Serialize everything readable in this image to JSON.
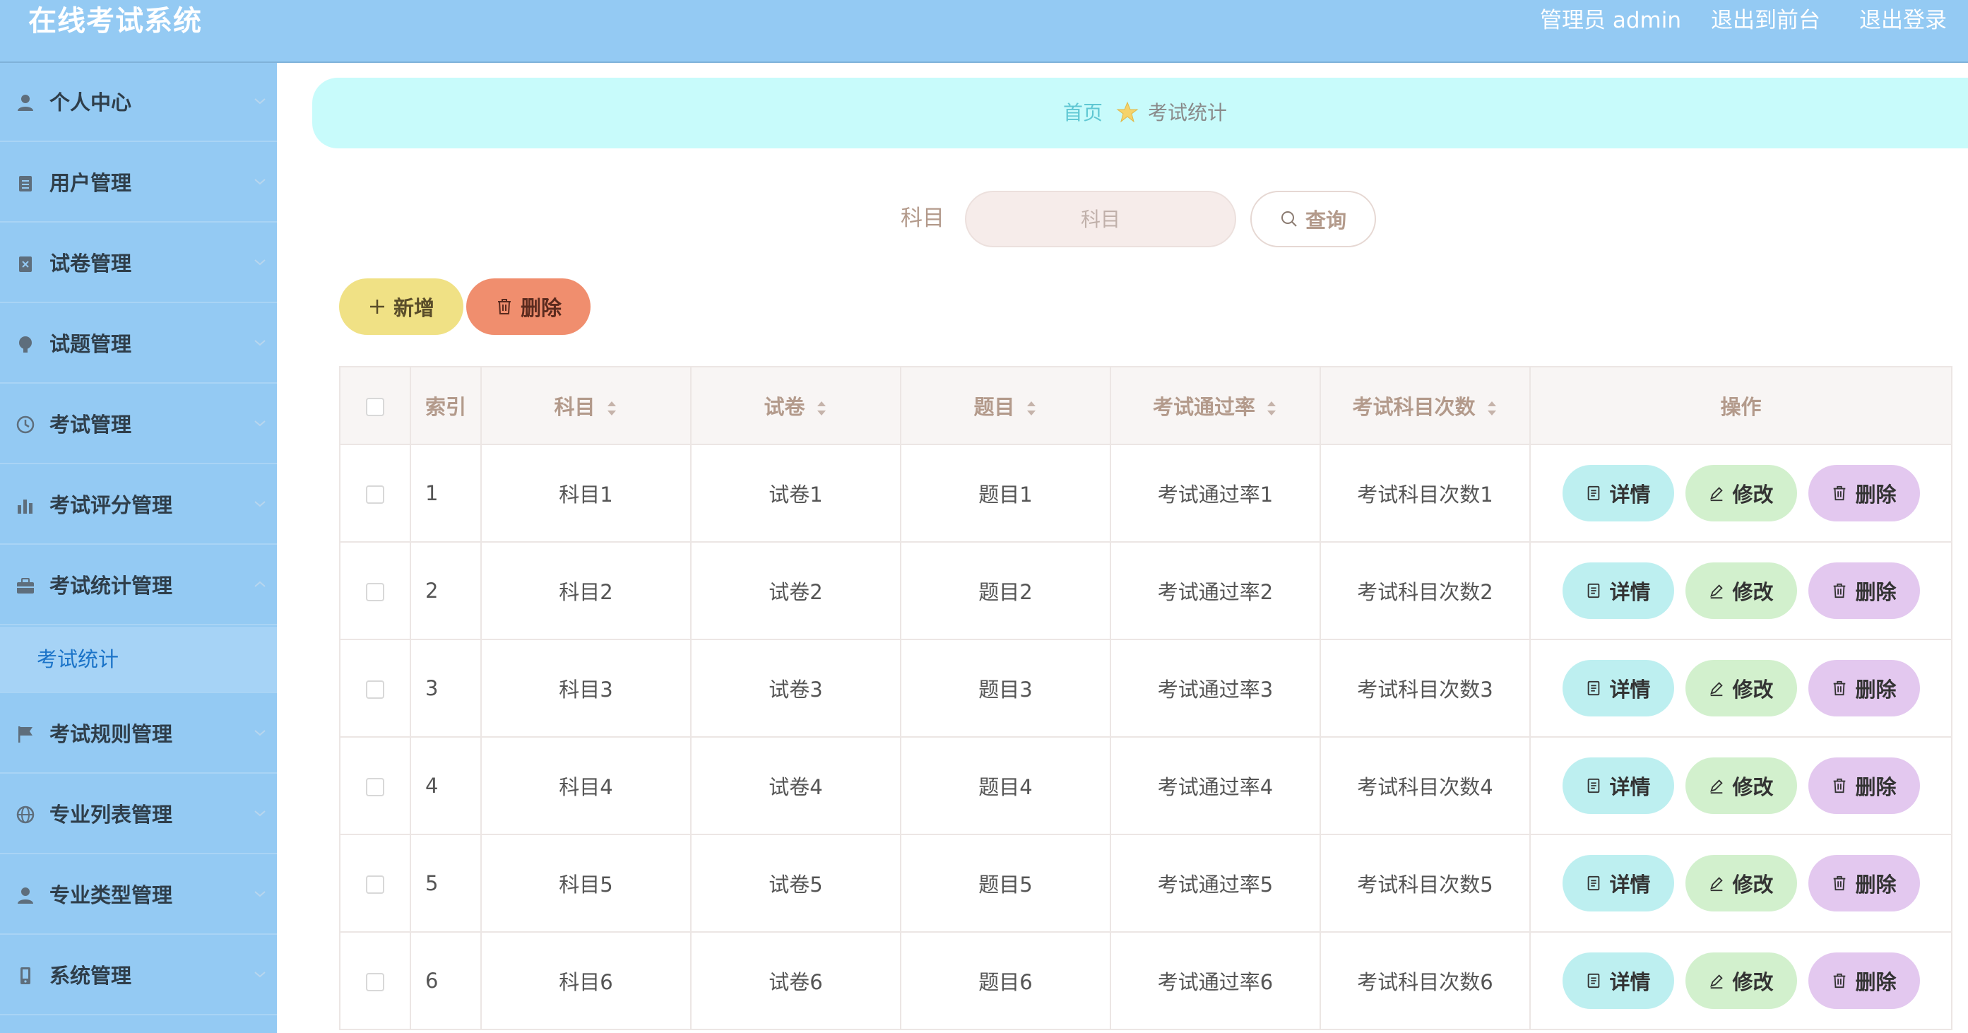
{
  "header": {
    "title": "在线考试系统",
    "user_label": "管理员 admin",
    "front_link": "退出到前台",
    "logout_link": "退出登录"
  },
  "sidebar": {
    "items": [
      {
        "label": "个人中心",
        "icon": "user-icon"
      },
      {
        "label": "用户管理",
        "icon": "clipboard-icon"
      },
      {
        "label": "试卷管理",
        "icon": "document-icon"
      },
      {
        "label": "试题管理",
        "icon": "lightbulb-icon"
      },
      {
        "label": "考试管理",
        "icon": "clock-icon"
      },
      {
        "label": "考试评分管理",
        "icon": "bar-chart-icon"
      },
      {
        "label": "考试统计管理",
        "icon": "briefcase-icon",
        "expanded": true
      },
      {
        "label": "考试规则管理",
        "icon": "flag-icon"
      },
      {
        "label": "专业列表管理",
        "icon": "globe-icon"
      },
      {
        "label": "专业类型管理",
        "icon": "user-icon"
      },
      {
        "label": "系统管理",
        "icon": "phone-icon"
      }
    ],
    "active_sub": "考试统计"
  },
  "breadcrumb": {
    "home": "首页",
    "current": "考试统计"
  },
  "search": {
    "label": "科目",
    "placeholder": "科目",
    "query_button": "查询"
  },
  "toolbar": {
    "add_label": "新增",
    "delete_label": "删除"
  },
  "table": {
    "headers": [
      "索引",
      "科目",
      "试卷",
      "题目",
      "考试通过率",
      "考试科目次数",
      "操作"
    ],
    "rows": [
      {
        "index": "1",
        "subject": "科目1",
        "paper": "试卷1",
        "question": "题目1",
        "pass_rate": "考试通过率1",
        "count": "考试科目次数1"
      },
      {
        "index": "2",
        "subject": "科目2",
        "paper": "试卷2",
        "question": "题目2",
        "pass_rate": "考试通过率2",
        "count": "考试科目次数2"
      },
      {
        "index": "3",
        "subject": "科目3",
        "paper": "试卷3",
        "question": "题目3",
        "pass_rate": "考试通过率3",
        "count": "考试科目次数3"
      },
      {
        "index": "4",
        "subject": "科目4",
        "paper": "试卷4",
        "question": "题目4",
        "pass_rate": "考试通过率4",
        "count": "考试科目次数4"
      },
      {
        "index": "5",
        "subject": "科目5",
        "paper": "试卷5",
        "question": "题目5",
        "pass_rate": "考试通过率5",
        "count": "考试科目次数5"
      },
      {
        "index": "6",
        "subject": "科目6",
        "paper": "试卷6",
        "question": "题目6",
        "pass_rate": "考试通过率6",
        "count": "考试科目次数6"
      }
    ],
    "actions": {
      "detail": "详情",
      "edit": "修改",
      "delete": "删除"
    }
  },
  "colors": {
    "header_bg": "#94caf3",
    "breadcrumb_bg": "#c8fbfb",
    "add_button": "#f0e185",
    "delete_button": "#f08e6e",
    "detail_button": "#bdeff0",
    "edit_button": "#d2f0cd",
    "row_delete_button": "#e3c8ef"
  }
}
